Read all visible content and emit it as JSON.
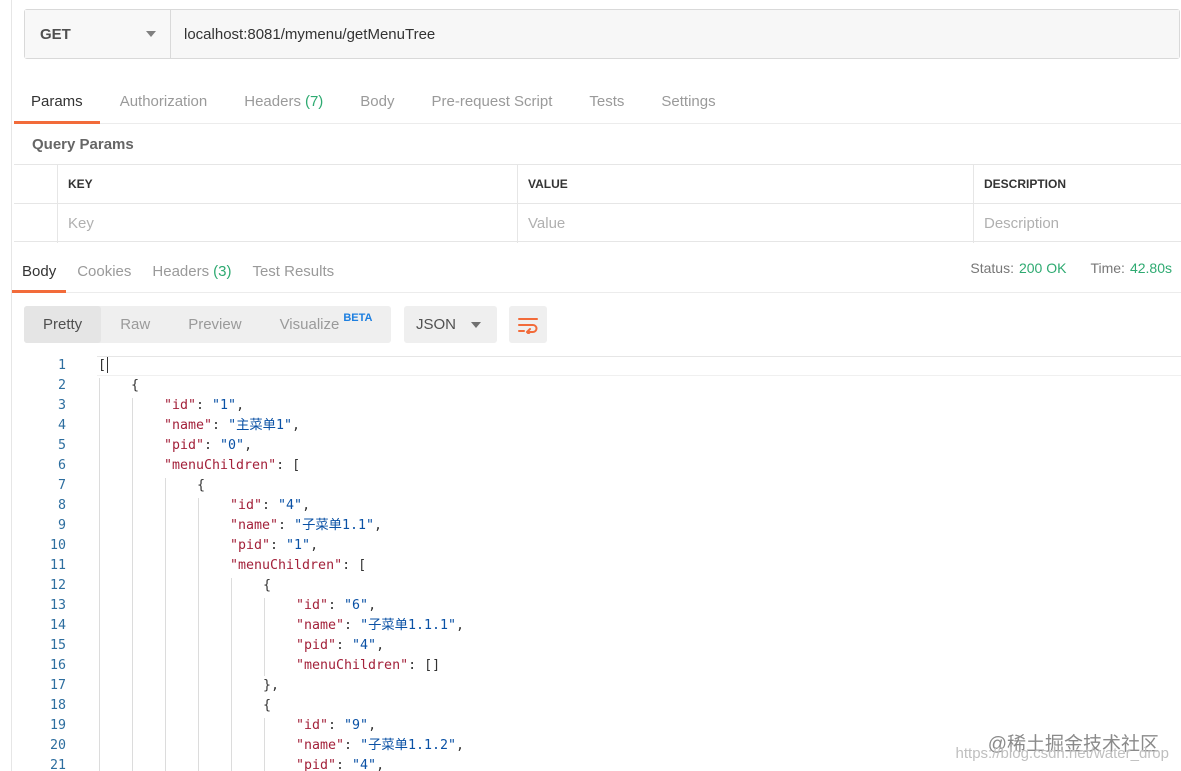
{
  "request": {
    "method": "GET",
    "url": "localhost:8081/mymenu/getMenuTree"
  },
  "request_tabs": [
    {
      "label": "Params",
      "count": ""
    },
    {
      "label": "Authorization",
      "count": ""
    },
    {
      "label": "Headers",
      "count": "(7)"
    },
    {
      "label": "Body",
      "count": ""
    },
    {
      "label": "Pre-request Script",
      "count": ""
    },
    {
      "label": "Tests",
      "count": ""
    },
    {
      "label": "Settings",
      "count": ""
    }
  ],
  "query_params": {
    "title": "Query Params",
    "columns": [
      "KEY",
      "VALUE",
      "DESCRIPTION"
    ],
    "placeholders": [
      "Key",
      "Value",
      "Description"
    ]
  },
  "response_tabs": [
    {
      "label": "Body",
      "count": ""
    },
    {
      "label": "Cookies",
      "count": ""
    },
    {
      "label": "Headers",
      "count": "(3)"
    },
    {
      "label": "Test Results",
      "count": ""
    }
  ],
  "status": {
    "status_label": "Status:",
    "status_value": "200 OK",
    "time_label": "Time:",
    "time_value": "42.80s"
  },
  "view_modes": [
    "Pretty",
    "Raw",
    "Preview",
    "Visualize"
  ],
  "beta_badge": "BETA",
  "format": "JSON",
  "colors": {
    "accent": "#f26b3a",
    "success": "#2eaa71",
    "json_key": "#a3213a",
    "json_string": "#0a51a5",
    "line_number": "#2d6e9f"
  },
  "code_lines": [
    {
      "n": "1",
      "indent": 0,
      "parts": [
        [
          "p",
          "["
        ]
      ]
    },
    {
      "n": "2",
      "indent": 1,
      "parts": [
        [
          "p",
          "{"
        ]
      ]
    },
    {
      "n": "3",
      "indent": 2,
      "parts": [
        [
          "k",
          "\"id\""
        ],
        [
          "p",
          ": "
        ],
        [
          "s",
          "\"1\""
        ],
        [
          "p",
          ","
        ]
      ]
    },
    {
      "n": "4",
      "indent": 2,
      "parts": [
        [
          "k",
          "\"name\""
        ],
        [
          "p",
          ": "
        ],
        [
          "s",
          "\"主菜单1\""
        ],
        [
          "p",
          ","
        ]
      ]
    },
    {
      "n": "5",
      "indent": 2,
      "parts": [
        [
          "k",
          "\"pid\""
        ],
        [
          "p",
          ": "
        ],
        [
          "s",
          "\"0\""
        ],
        [
          "p",
          ","
        ]
      ]
    },
    {
      "n": "6",
      "indent": 2,
      "parts": [
        [
          "k",
          "\"menuChildren\""
        ],
        [
          "p",
          ": ["
        ]
      ]
    },
    {
      "n": "7",
      "indent": 3,
      "parts": [
        [
          "p",
          "{"
        ]
      ]
    },
    {
      "n": "8",
      "indent": 4,
      "parts": [
        [
          "k",
          "\"id\""
        ],
        [
          "p",
          ": "
        ],
        [
          "s",
          "\"4\""
        ],
        [
          "p",
          ","
        ]
      ]
    },
    {
      "n": "9",
      "indent": 4,
      "parts": [
        [
          "k",
          "\"name\""
        ],
        [
          "p",
          ": "
        ],
        [
          "s",
          "\"子菜单1.1\""
        ],
        [
          "p",
          ","
        ]
      ]
    },
    {
      "n": "10",
      "indent": 4,
      "parts": [
        [
          "k",
          "\"pid\""
        ],
        [
          "p",
          ": "
        ],
        [
          "s",
          "\"1\""
        ],
        [
          "p",
          ","
        ]
      ]
    },
    {
      "n": "11",
      "indent": 4,
      "parts": [
        [
          "k",
          "\"menuChildren\""
        ],
        [
          "p",
          ": ["
        ]
      ]
    },
    {
      "n": "12",
      "indent": 5,
      "parts": [
        [
          "p",
          "{"
        ]
      ]
    },
    {
      "n": "13",
      "indent": 6,
      "parts": [
        [
          "k",
          "\"id\""
        ],
        [
          "p",
          ": "
        ],
        [
          "s",
          "\"6\""
        ],
        [
          "p",
          ","
        ]
      ]
    },
    {
      "n": "14",
      "indent": 6,
      "parts": [
        [
          "k",
          "\"name\""
        ],
        [
          "p",
          ": "
        ],
        [
          "s",
          "\"子菜单1.1.1\""
        ],
        [
          "p",
          ","
        ]
      ]
    },
    {
      "n": "15",
      "indent": 6,
      "parts": [
        [
          "k",
          "\"pid\""
        ],
        [
          "p",
          ": "
        ],
        [
          "s",
          "\"4\""
        ],
        [
          "p",
          ","
        ]
      ]
    },
    {
      "n": "16",
      "indent": 6,
      "parts": [
        [
          "k",
          "\"menuChildren\""
        ],
        [
          "p",
          ": []"
        ]
      ]
    },
    {
      "n": "17",
      "indent": 5,
      "parts": [
        [
          "p",
          "},"
        ]
      ]
    },
    {
      "n": "18",
      "indent": 5,
      "parts": [
        [
          "p",
          "{"
        ]
      ]
    },
    {
      "n": "19",
      "indent": 6,
      "parts": [
        [
          "k",
          "\"id\""
        ],
        [
          "p",
          ": "
        ],
        [
          "s",
          "\"9\""
        ],
        [
          "p",
          ","
        ]
      ]
    },
    {
      "n": "20",
      "indent": 6,
      "parts": [
        [
          "k",
          "\"name\""
        ],
        [
          "p",
          ": "
        ],
        [
          "s",
          "\"子菜单1.1.2\""
        ],
        [
          "p",
          ","
        ]
      ]
    },
    {
      "n": "21",
      "indent": 6,
      "parts": [
        [
          "k",
          "\"pid\""
        ],
        [
          "p",
          ": "
        ],
        [
          "s",
          "\"4\""
        ],
        [
          "p",
          ","
        ]
      ]
    }
  ],
  "watermark": "@稀土掘金技术社区",
  "watermark_url": "https://blog.csdn.net/water_drop"
}
